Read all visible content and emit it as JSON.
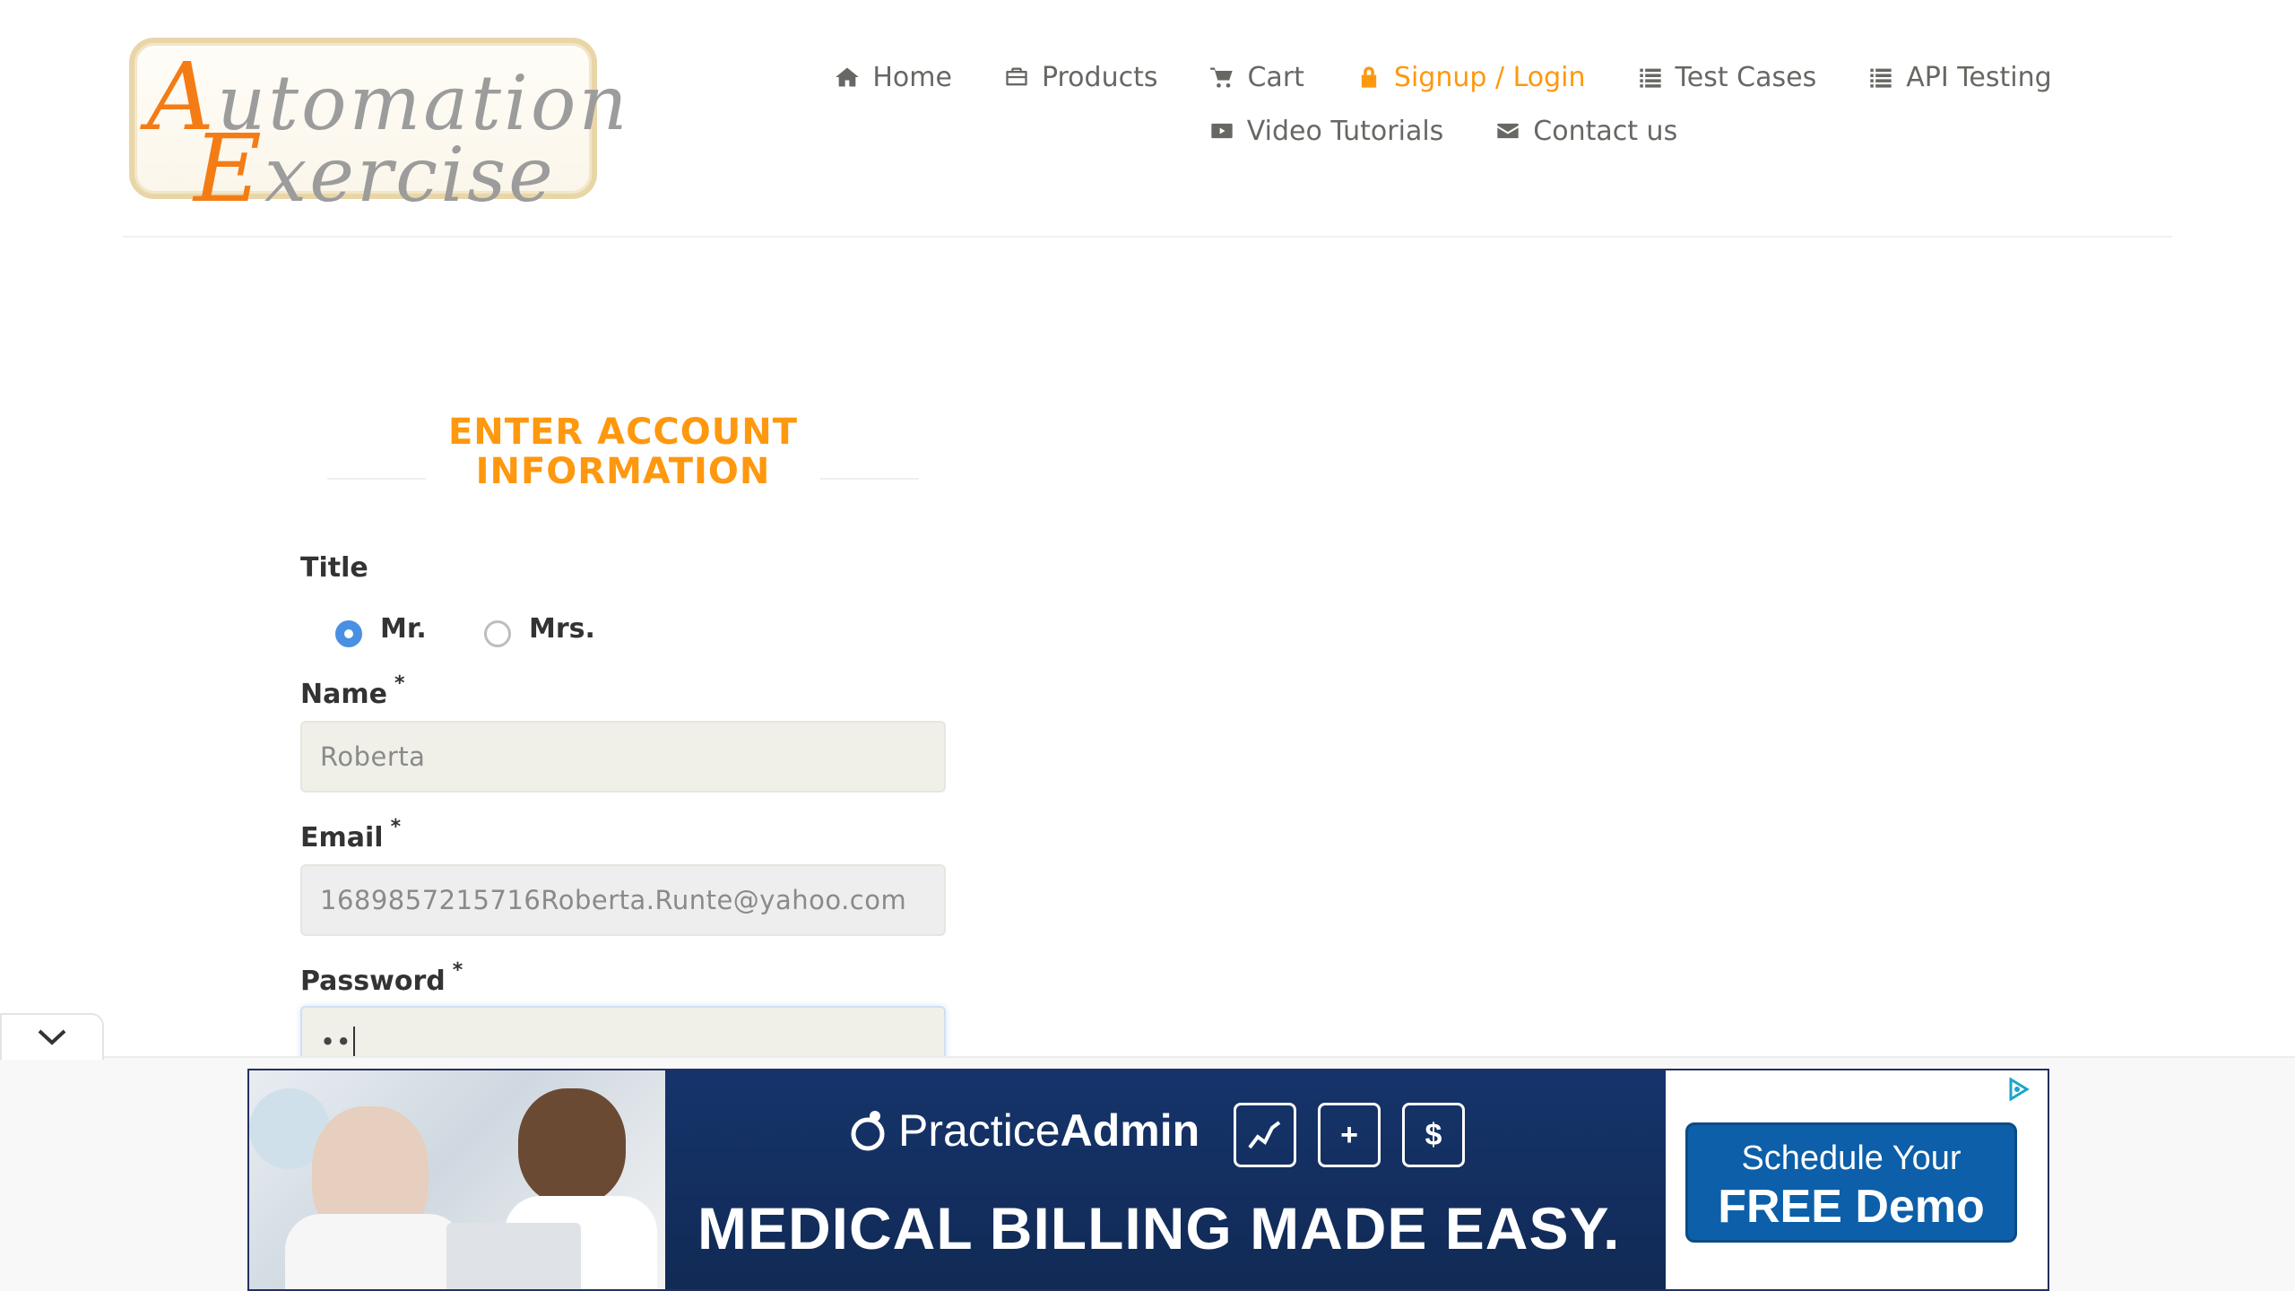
{
  "logo": {
    "line1_cap": "A",
    "line1_rest": "utomation",
    "line2_cap": "E",
    "line2_rest": "xercise"
  },
  "nav": {
    "row1": [
      {
        "label": "Home",
        "icon": "home-icon"
      },
      {
        "label": "Products",
        "icon": "briefcase-icon"
      },
      {
        "label": "Cart",
        "icon": "cart-icon"
      },
      {
        "label": "Signup / Login",
        "icon": "lock-icon",
        "active": true
      },
      {
        "label": "Test Cases",
        "icon": "list-icon"
      },
      {
        "label": "API Testing",
        "icon": "list-icon"
      }
    ],
    "row2": [
      {
        "label": "Video Tutorials",
        "icon": "youtube-icon"
      },
      {
        "label": "Contact us",
        "icon": "envelope-icon"
      }
    ]
  },
  "colors": {
    "accent": "#fe980f",
    "text": "#696763",
    "input_bg": "#f0f0e9",
    "ad_blue": "#13315f"
  },
  "form": {
    "heading_line1": "ENTER ACCOUNT",
    "heading_line2": "INFORMATION",
    "title_label": "Title",
    "title_options": [
      {
        "label": "Mr.",
        "checked": true
      },
      {
        "label": "Mrs.",
        "checked": false
      }
    ],
    "name_label": "Name",
    "name_value": "Roberta",
    "email_label": "Email",
    "email_value": "1689857215716Roberta.Runte@yahoo.com",
    "password_label": "Password",
    "password_value": "••",
    "required_mark": "*"
  },
  "ad": {
    "brand_prefix": "Practice",
    "brand_bold": "Admin",
    "icon_labels": [
      "",
      "+",
      "$"
    ],
    "headline": "MEDICAL BILLING MADE EASY.",
    "cta_line1": "Schedule Your",
    "cta_line2": "FREE Demo",
    "collapse_icon": "chevron-down-icon",
    "adchoices_icon": "adchoices-icon"
  }
}
